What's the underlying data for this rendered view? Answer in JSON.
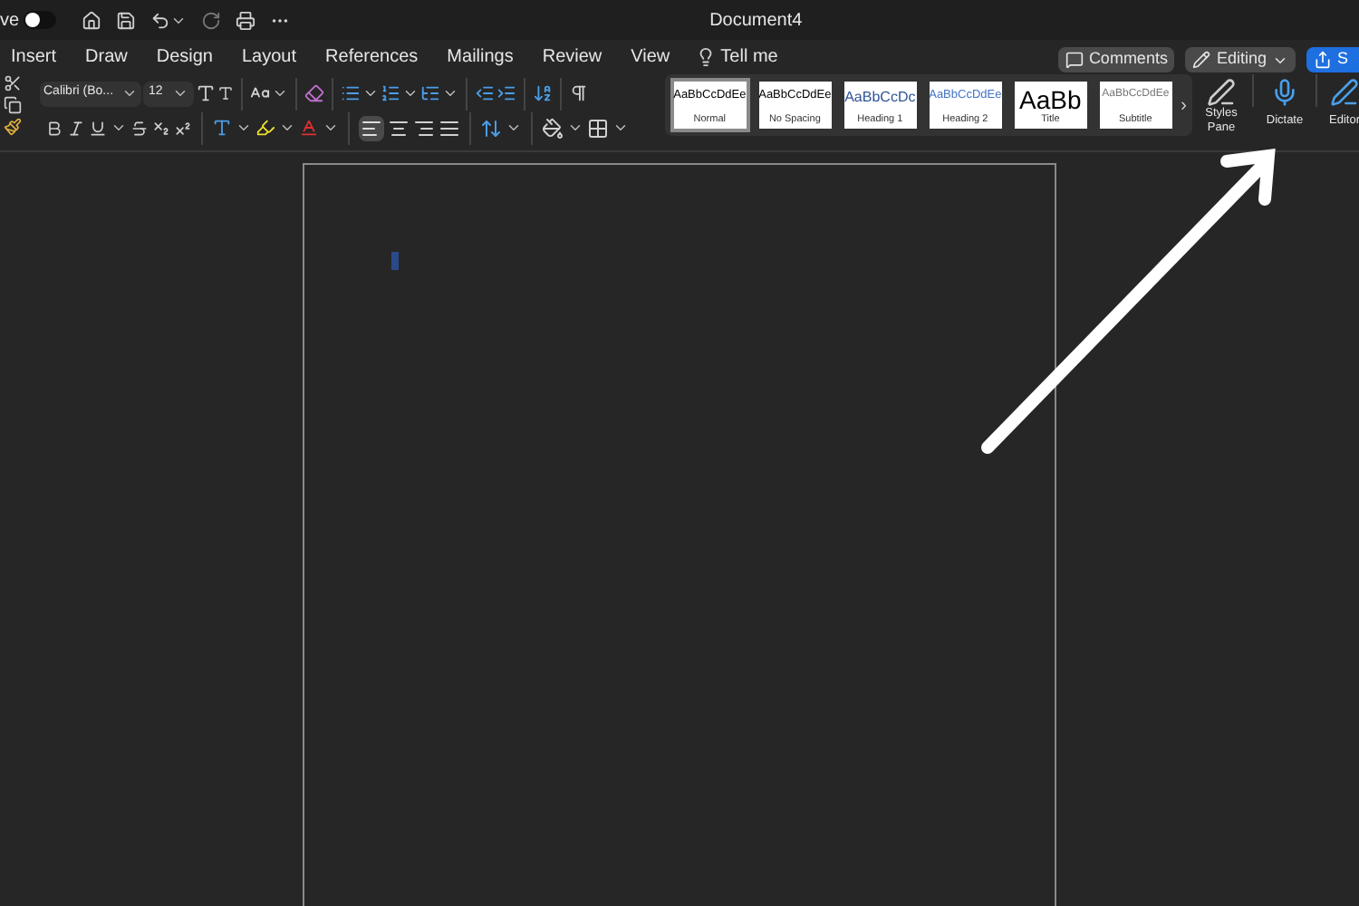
{
  "title_bar": {
    "autosave_label": "ve",
    "autosave_on": false,
    "title": "Document4"
  },
  "menu_tabs": [
    "Insert",
    "Draw",
    "Design",
    "Layout",
    "References",
    "Mailings",
    "Review",
    "View"
  ],
  "tell_me": "Tell me",
  "actions": {
    "comments": "Comments",
    "editing": "Editing",
    "share": "S"
  },
  "font": {
    "name": "Calibri (Bo...",
    "size": "12"
  },
  "styles": [
    {
      "kind": "normal",
      "preview": "AaBbCcDdEe",
      "label": "Normal",
      "selected": true
    },
    {
      "kind": "normal",
      "preview": "AaBbCcDdEe",
      "label": "No Spacing",
      "selected": false
    },
    {
      "kind": "heading1",
      "preview": "AaBbCcDc",
      "label": "Heading 1",
      "selected": false
    },
    {
      "kind": "heading2",
      "preview": "AaBbCcDdEe",
      "label": "Heading 2",
      "selected": false
    },
    {
      "kind": "title",
      "preview": "AaBb",
      "label": "Title",
      "selected": false
    },
    {
      "kind": "subtitle",
      "preview": "AaBbCcDdEe",
      "label": "Subtitle",
      "selected": false
    }
  ],
  "more_styles": "›",
  "styles_pane": "Styles Pane",
  "dictate": "Dictate",
  "editor": "Editor"
}
